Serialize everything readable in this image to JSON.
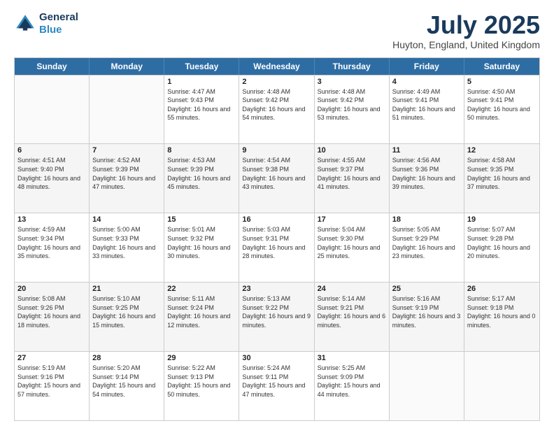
{
  "header": {
    "logo_line1": "General",
    "logo_line2": "Blue",
    "month": "July 2025",
    "location": "Huyton, England, United Kingdom"
  },
  "weekdays": [
    "Sunday",
    "Monday",
    "Tuesday",
    "Wednesday",
    "Thursday",
    "Friday",
    "Saturday"
  ],
  "rows": [
    [
      {
        "day": "",
        "text": "",
        "empty": true
      },
      {
        "day": "",
        "text": "",
        "empty": true
      },
      {
        "day": "1",
        "text": "Sunrise: 4:47 AM\nSunset: 9:43 PM\nDaylight: 16 hours and 55 minutes."
      },
      {
        "day": "2",
        "text": "Sunrise: 4:48 AM\nSunset: 9:42 PM\nDaylight: 16 hours and 54 minutes."
      },
      {
        "day": "3",
        "text": "Sunrise: 4:48 AM\nSunset: 9:42 PM\nDaylight: 16 hours and 53 minutes."
      },
      {
        "day": "4",
        "text": "Sunrise: 4:49 AM\nSunset: 9:41 PM\nDaylight: 16 hours and 51 minutes."
      },
      {
        "day": "5",
        "text": "Sunrise: 4:50 AM\nSunset: 9:41 PM\nDaylight: 16 hours and 50 minutes."
      }
    ],
    [
      {
        "day": "6",
        "text": "Sunrise: 4:51 AM\nSunset: 9:40 PM\nDaylight: 16 hours and 48 minutes."
      },
      {
        "day": "7",
        "text": "Sunrise: 4:52 AM\nSunset: 9:39 PM\nDaylight: 16 hours and 47 minutes."
      },
      {
        "day": "8",
        "text": "Sunrise: 4:53 AM\nSunset: 9:39 PM\nDaylight: 16 hours and 45 minutes."
      },
      {
        "day": "9",
        "text": "Sunrise: 4:54 AM\nSunset: 9:38 PM\nDaylight: 16 hours and 43 minutes."
      },
      {
        "day": "10",
        "text": "Sunrise: 4:55 AM\nSunset: 9:37 PM\nDaylight: 16 hours and 41 minutes."
      },
      {
        "day": "11",
        "text": "Sunrise: 4:56 AM\nSunset: 9:36 PM\nDaylight: 16 hours and 39 minutes."
      },
      {
        "day": "12",
        "text": "Sunrise: 4:58 AM\nSunset: 9:35 PM\nDaylight: 16 hours and 37 minutes."
      }
    ],
    [
      {
        "day": "13",
        "text": "Sunrise: 4:59 AM\nSunset: 9:34 PM\nDaylight: 16 hours and 35 minutes."
      },
      {
        "day": "14",
        "text": "Sunrise: 5:00 AM\nSunset: 9:33 PM\nDaylight: 16 hours and 33 minutes."
      },
      {
        "day": "15",
        "text": "Sunrise: 5:01 AM\nSunset: 9:32 PM\nDaylight: 16 hours and 30 minutes."
      },
      {
        "day": "16",
        "text": "Sunrise: 5:03 AM\nSunset: 9:31 PM\nDaylight: 16 hours and 28 minutes."
      },
      {
        "day": "17",
        "text": "Sunrise: 5:04 AM\nSunset: 9:30 PM\nDaylight: 16 hours and 25 minutes."
      },
      {
        "day": "18",
        "text": "Sunrise: 5:05 AM\nSunset: 9:29 PM\nDaylight: 16 hours and 23 minutes."
      },
      {
        "day": "19",
        "text": "Sunrise: 5:07 AM\nSunset: 9:28 PM\nDaylight: 16 hours and 20 minutes."
      }
    ],
    [
      {
        "day": "20",
        "text": "Sunrise: 5:08 AM\nSunset: 9:26 PM\nDaylight: 16 hours and 18 minutes."
      },
      {
        "day": "21",
        "text": "Sunrise: 5:10 AM\nSunset: 9:25 PM\nDaylight: 16 hours and 15 minutes."
      },
      {
        "day": "22",
        "text": "Sunrise: 5:11 AM\nSunset: 9:24 PM\nDaylight: 16 hours and 12 minutes."
      },
      {
        "day": "23",
        "text": "Sunrise: 5:13 AM\nSunset: 9:22 PM\nDaylight: 16 hours and 9 minutes."
      },
      {
        "day": "24",
        "text": "Sunrise: 5:14 AM\nSunset: 9:21 PM\nDaylight: 16 hours and 6 minutes."
      },
      {
        "day": "25",
        "text": "Sunrise: 5:16 AM\nSunset: 9:19 PM\nDaylight: 16 hours and 3 minutes."
      },
      {
        "day": "26",
        "text": "Sunrise: 5:17 AM\nSunset: 9:18 PM\nDaylight: 16 hours and 0 minutes."
      }
    ],
    [
      {
        "day": "27",
        "text": "Sunrise: 5:19 AM\nSunset: 9:16 PM\nDaylight: 15 hours and 57 minutes."
      },
      {
        "day": "28",
        "text": "Sunrise: 5:20 AM\nSunset: 9:14 PM\nDaylight: 15 hours and 54 minutes."
      },
      {
        "day": "29",
        "text": "Sunrise: 5:22 AM\nSunset: 9:13 PM\nDaylight: 15 hours and 50 minutes."
      },
      {
        "day": "30",
        "text": "Sunrise: 5:24 AM\nSunset: 9:11 PM\nDaylight: 15 hours and 47 minutes."
      },
      {
        "day": "31",
        "text": "Sunrise: 5:25 AM\nSunset: 9:09 PM\nDaylight: 15 hours and 44 minutes."
      },
      {
        "day": "",
        "text": "",
        "empty": true
      },
      {
        "day": "",
        "text": "",
        "empty": true
      }
    ]
  ]
}
